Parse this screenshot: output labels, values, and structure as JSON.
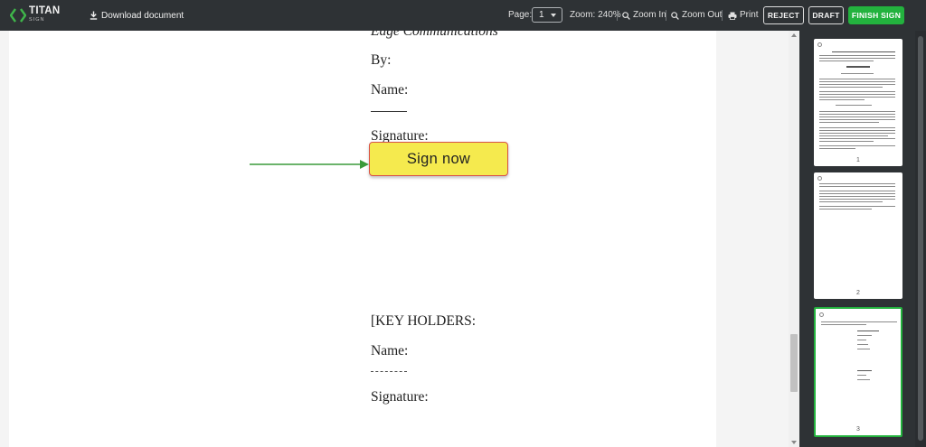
{
  "app": {
    "logo_text": "TITAN",
    "logo_sub": "SIGN"
  },
  "toolbar": {
    "download_label": "Download document",
    "page_label": "Page:",
    "page_value": "1",
    "zoom_label": "Zoom: 240%",
    "zoom_in_label": "Zoom In",
    "zoom_out_label": "Zoom Out",
    "print_label": "Print",
    "reject_label": "REJECT",
    "draft_label": "DRAFT",
    "finish_label": "FINISH SIGN"
  },
  "document": {
    "lines": [
      "Edge Communications",
      "By:",
      "Name:",
      "Signature:",
      "[KEY HOLDERS:",
      "Name:",
      "Signature:"
    ],
    "sign_button_label": "Sign now"
  },
  "thumbnails": [
    {
      "number": "1"
    },
    {
      "number": "2"
    },
    {
      "number": "3"
    }
  ],
  "colors": {
    "topbar_bg": "#2e3235",
    "accent_green": "#23b23e",
    "sign_button_bg": "#f5ea4e",
    "sign_button_border": "#d9504a"
  }
}
